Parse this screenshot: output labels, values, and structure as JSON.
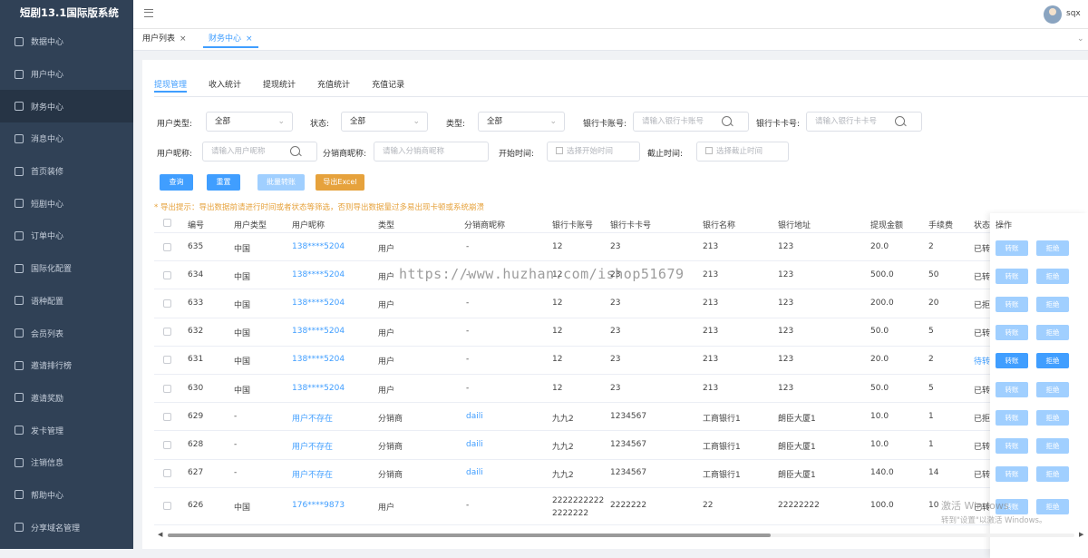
{
  "app": {
    "title": "短剧13.1国际版系统",
    "username": "sqx"
  },
  "sidebar": {
    "items": [
      {
        "label": "数据中心",
        "icon": "chart-icon"
      },
      {
        "label": "用户中心",
        "icon": "user-icon"
      },
      {
        "label": "财务中心",
        "icon": "wallet-icon",
        "active": true
      },
      {
        "label": "消息中心",
        "icon": "message-icon"
      },
      {
        "label": "首页装修",
        "icon": "cube-icon"
      },
      {
        "label": "短剧中心",
        "icon": "film-icon"
      },
      {
        "label": "订单中心",
        "icon": "calendar-icon"
      },
      {
        "label": "国际化配置",
        "icon": "mail-icon"
      },
      {
        "label": "语种配置",
        "icon": "gear-icon"
      },
      {
        "label": "会员列表",
        "icon": "list-icon"
      },
      {
        "label": "邀请排行榜",
        "icon": "ranking-icon"
      },
      {
        "label": "邀请奖励",
        "icon": "trend-icon"
      },
      {
        "label": "发卡管理",
        "icon": "card-icon"
      },
      {
        "label": "注销信息",
        "icon": "lock-icon"
      },
      {
        "label": "帮助中心",
        "icon": "help-icon"
      },
      {
        "label": "分享域名管理",
        "icon": "share-icon"
      }
    ]
  },
  "tags": [
    {
      "label": "用户列表",
      "active": false
    },
    {
      "label": "财务中心",
      "active": true
    }
  ],
  "subtabs": [
    "提现管理",
    "收入统计",
    "提现统计",
    "充值统计",
    "充值记录"
  ],
  "filters": {
    "user_type_label": "用户类型:",
    "user_type_value": "全部",
    "status_label": "状态:",
    "status_value": "全部",
    "type_label": "类型:",
    "type_value": "全部",
    "bank_account_label": "银行卡账号:",
    "bank_account_placeholder": "请输入银行卡账号",
    "bank_card_label": "银行卡卡号:",
    "bank_card_placeholder": "请输入银行卡卡号",
    "nickname_label": "用户昵称:",
    "nickname_placeholder": "请输入用户昵称",
    "agent_label": "分销商昵称:",
    "agent_placeholder": "请输入分销商昵称",
    "start_label": "开始时间:",
    "start_placeholder": "选择开始时间",
    "end_label": "截止时间:",
    "end_placeholder": "选择截止时间"
  },
  "buttons": {
    "query": "查询",
    "reset": "重置",
    "batch": "批量转账",
    "export": "导出Excel"
  },
  "tip": "* 导出提示：导出数据前请进行时间或者状态等筛选，否则导出数据量过多易出现卡顿或系统崩溃",
  "table": {
    "headers": [
      "编号",
      "用户类型",
      "用户昵称",
      "类型",
      "分销商昵称",
      "银行卡账号",
      "银行卡卡号",
      "银行名称",
      "银行地址",
      "提现金额",
      "手续费",
      "状态",
      "操作"
    ],
    "action_transfer": "转账",
    "action_reject": "拒绝",
    "rows": [
      {
        "id": "635",
        "utype": "中国",
        "nick": "138****5204",
        "type": "用户",
        "agent": "-",
        "acct": "12",
        "acct2": "",
        "card": "23",
        "bank": "213",
        "addr": "123",
        "amount": "20.0",
        "fee": "2",
        "status": "已转",
        "enabled": false
      },
      {
        "id": "634",
        "utype": "中国",
        "nick": "138****5204",
        "type": "用户",
        "agent": "-",
        "acct": "12",
        "acct2": "",
        "card": "23",
        "bank": "213",
        "addr": "123",
        "amount": "500.0",
        "fee": "50",
        "status": "已转",
        "enabled": false
      },
      {
        "id": "633",
        "utype": "中国",
        "nick": "138****5204",
        "type": "用户",
        "agent": "-",
        "acct": "12",
        "acct2": "",
        "card": "23",
        "bank": "213",
        "addr": "123",
        "amount": "200.0",
        "fee": "20",
        "status": "已拒",
        "enabled": false
      },
      {
        "id": "632",
        "utype": "中国",
        "nick": "138****5204",
        "type": "用户",
        "agent": "-",
        "acct": "12",
        "acct2": "",
        "card": "23",
        "bank": "213",
        "addr": "123",
        "amount": "50.0",
        "fee": "5",
        "status": "已转",
        "enabled": false
      },
      {
        "id": "631",
        "utype": "中国",
        "nick": "138****5204",
        "type": "用户",
        "agent": "-",
        "acct": "12",
        "acct2": "",
        "card": "23",
        "bank": "213",
        "addr": "123",
        "amount": "20.0",
        "fee": "2",
        "status": "待转",
        "enabled": true
      },
      {
        "id": "630",
        "utype": "中国",
        "nick": "138****5204",
        "type": "用户",
        "agent": "-",
        "acct": "12",
        "acct2": "",
        "card": "23",
        "bank": "213",
        "addr": "123",
        "amount": "50.0",
        "fee": "5",
        "status": "已转",
        "enabled": false
      },
      {
        "id": "629",
        "utype": "-",
        "nick": "用户不存在",
        "type": "分销商",
        "agent": "daili",
        "acct": "九九2",
        "acct2": "",
        "card": "1234567",
        "bank": "工商银行1",
        "addr": "朗臣大厦1",
        "amount": "10.0",
        "fee": "1",
        "status": "已拒",
        "enabled": false
      },
      {
        "id": "628",
        "utype": "-",
        "nick": "用户不存在",
        "type": "分销商",
        "agent": "daili",
        "acct": "九九2",
        "acct2": "",
        "card": "1234567",
        "bank": "工商银行1",
        "addr": "朗臣大厦1",
        "amount": "10.0",
        "fee": "1",
        "status": "已转",
        "enabled": false
      },
      {
        "id": "627",
        "utype": "-",
        "nick": "用户不存在",
        "type": "分销商",
        "agent": "daili",
        "acct": "九九2",
        "acct2": "",
        "card": "1234567",
        "bank": "工商银行1",
        "addr": "朗臣大厦1",
        "amount": "140.0",
        "fee": "14",
        "status": "已转",
        "enabled": false
      },
      {
        "id": "626",
        "utype": "中国",
        "nick": "176****9873",
        "type": "用户",
        "agent": "-",
        "acct": "2222222222",
        "acct2": "2222222",
        "card": "2222222",
        "bank": "22",
        "addr": "22222222",
        "amount": "100.0",
        "fee": "10",
        "status": "已转",
        "enabled": false
      }
    ]
  },
  "overlay": {
    "watermark": "https://www.huzhan.com/ishop51679",
    "activate_title": "激活 Windows",
    "activate_sub": "转到\"设置\"以激活 Windows。"
  }
}
